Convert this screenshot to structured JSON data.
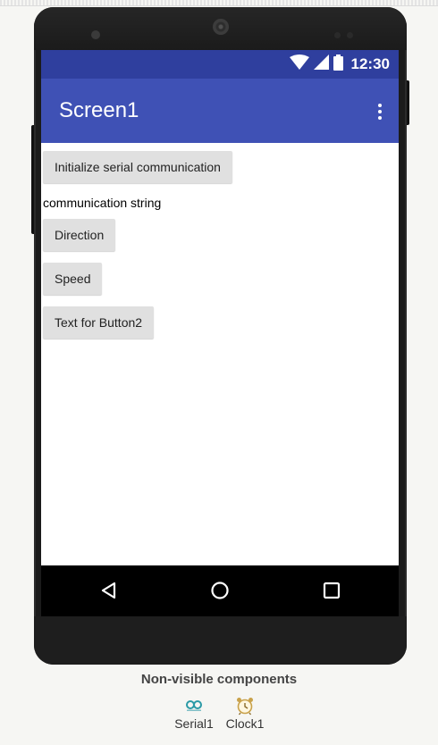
{
  "status_bar": {
    "time": "12:30"
  },
  "app_bar": {
    "title": "Screen1"
  },
  "components": {
    "init_button": "Initialize serial communication",
    "comm_label": "communication string",
    "direction_button": "Direction",
    "speed_button": "Speed",
    "button2": "Text for Button2"
  },
  "non_visible": {
    "title": "Non-visible components",
    "items": [
      {
        "label": "Serial1",
        "icon": "arduino-icon"
      },
      {
        "label": "Clock1",
        "icon": "alarm-clock-icon"
      }
    ]
  },
  "colors": {
    "status_bar": "#2f3f9e",
    "app_bar": "#3f51b5",
    "button_bg": "#e0e0e0",
    "nav_bar": "#000000"
  }
}
